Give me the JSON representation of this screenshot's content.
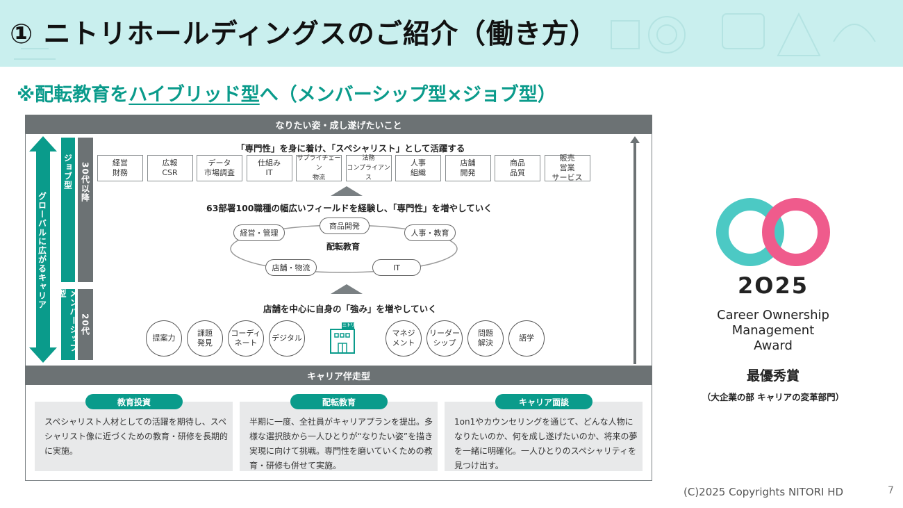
{
  "header": {
    "title": "① ニトリホールディングスのご紹介（働き方）"
  },
  "subtitle": {
    "prefix": "※配転教育を",
    "underlined": "ハイブリッド型",
    "suffix": "へ（メンバーシップ型×ジョブ型）"
  },
  "diagram": {
    "top_bar": "なりたい姿・成し遂げたいこと",
    "left_arrow_label": "グローバルに広がるキャリア",
    "job_type_label": "ジョブ型",
    "membership_type_label": "メンバーシップ型",
    "age_30": "30代以降",
    "age_20": "20代",
    "specialist_heading": "「専門性」を身に着け、「スペシャリスト」として活躍する",
    "fields": [
      "経営\n財務",
      "広報\nCSR",
      "データ\n市場調査",
      "仕組み\nIT",
      "サプライチェーン\n物流",
      "法務\nコンプライアンス",
      "人事\n組織",
      "店舗\n開発",
      "商品\n品質",
      "販売\n営業\nサービス"
    ],
    "field_heading": "63部署100職種の幅広いフィールドを経験し、「専門性」を増やしていく",
    "rotation_center": "配転教育",
    "rotation_items": [
      "経営・管理",
      "商品開発",
      "人事・教育",
      "店舗・物流",
      "IT"
    ],
    "store_heading": "店舗を中心に自身の「強み」を増やしていく",
    "store_sign": "ニトリ",
    "skills_left": [
      "提案力",
      "課題\n発見",
      "コーディ\nネート",
      "デジタル"
    ],
    "skills_right": [
      "マネジ\nメント",
      "リーダー\nシップ",
      "問題\n解決",
      "語学"
    ],
    "mid_bar": "キャリア伴走型"
  },
  "cards": [
    {
      "tag": "教育投資",
      "text": "スペシャリスト人材としての活躍を期待し、スペシャリスト像に近づくための教育・研修を長期的に実施。"
    },
    {
      "tag": "配転教育",
      "text": "半期に一度、全社員がキャリアプランを提出。多様な選択肢から一人ひとりが“なりたい姿”を描き実現に向けて挑戦。専門性を磨いていくための教育・研修も併せて実施。"
    },
    {
      "tag": "キャリア面談",
      "text": "1on1やカウンセリングを通じて、どんな人物になりたいのか、何を成し遂げたいのか、将来の夢を一緒に明確化。一人ひとりのスペシャリティを見つけ出す。"
    }
  ],
  "award": {
    "year": "2O25",
    "name_line1": "Career Ownership",
    "name_line2": "Management",
    "name_line3": "Award",
    "prize": "最優秀賞",
    "department": "（大企業の部 キャリアの変革部門）"
  },
  "footer": {
    "copyright": "(C)2025 Copyrights NITORI HD",
    "page": "7"
  },
  "colors": {
    "header_bg": "#c9efee",
    "teal": "#0a9b8b",
    "grey_bar": "#6c7274",
    "logo_cyan": "#4cc9c4",
    "logo_pink": "#ef5b8c"
  }
}
